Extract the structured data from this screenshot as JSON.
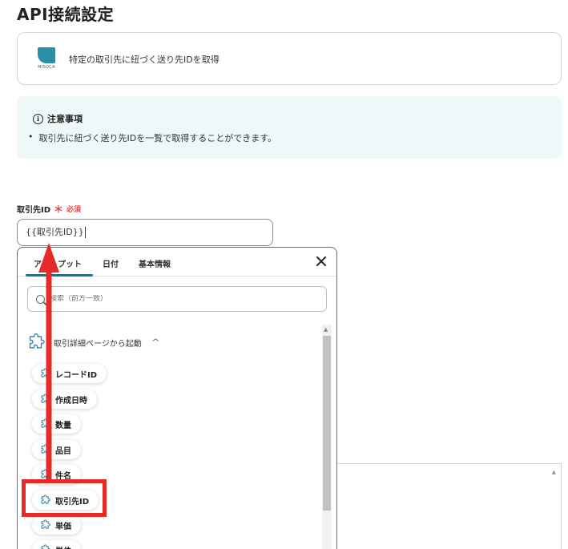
{
  "page": {
    "title": "API接続設定"
  },
  "app_card": {
    "logo_text": "MISOCA",
    "action": "特定の取引先に紐づく送り先IDを取得"
  },
  "notice": {
    "title": "注意事項",
    "items": [
      "取引先に紐づく送り先IDを一覧で取得することができます。"
    ]
  },
  "field": {
    "label": "取引先ID",
    "required_mark": "＊",
    "required_text": "必須",
    "value": "{{取引先ID}}"
  },
  "dropdown": {
    "tabs": [
      {
        "label": "アウトプット",
        "active": true
      },
      {
        "label": "日付",
        "active": false
      },
      {
        "label": "基本情報",
        "active": false
      }
    ],
    "search_placeholder": "検索（前方一致）",
    "group": {
      "label": "取引詳細ページから起動"
    },
    "items": [
      "レコードID",
      "作成日時",
      "数量",
      "品目",
      "件名",
      "取引先ID",
      "単価",
      "単位"
    ]
  },
  "colors": {
    "accent": "#2a6d88",
    "required": "#e04848",
    "annotation": "#e52a2a",
    "notice_bg": "#eff8f8"
  }
}
